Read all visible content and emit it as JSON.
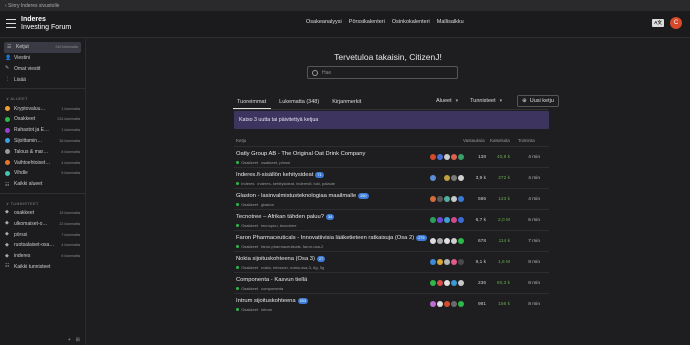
{
  "topstrip": {
    "back_label": "‹ Siirry Inderes sivustolle"
  },
  "brand": {
    "line1": "Inderes",
    "line2": "Investing Forum"
  },
  "topnav": [
    "Osakeanalyysi",
    "Pörssikalenteri",
    "Osinkokalenteri",
    "Mallisalkku"
  ],
  "header": {
    "lang": "A文",
    "avatar": "C"
  },
  "sidebar": {
    "top": [
      {
        "label": "Ketjut",
        "count": "240 lukematta",
        "icon": "☰",
        "active": true
      },
      {
        "label": "Viestini",
        "count": "",
        "icon": "👤",
        "active": false
      },
      {
        "label": "Omat viestit",
        "count": "",
        "icon": "✎",
        "active": false
      },
      {
        "label": "Lisää",
        "count": "",
        "icon": "⋮",
        "active": false
      }
    ],
    "alueet_head": "∨ ALUEET",
    "alueet": [
      {
        "label": "Kryptovaluu…",
        "count": "1 lukematta",
        "color": "#f0a030"
      },
      {
        "label": "Osakkeet",
        "count": "234 lukematta",
        "color": "#2db84a"
      },
      {
        "label": "Rahastot ja E…",
        "count": "1 lukematta",
        "color": "#9b3fd4"
      },
      {
        "label": "Sijoittamin…",
        "count": "36 lukematta",
        "color": "#3aa0e6"
      },
      {
        "label": "Talous & mar…",
        "count": "8 lukematta",
        "color": "#9a9a9a"
      },
      {
        "label": "Vaihtoehtoiset…",
        "count": "4 lukematta",
        "color": "#e8742a"
      },
      {
        "label": "Vihdle",
        "count": "5 lukematta",
        "color": "#44c2b4"
      },
      {
        "label": "Kaikki alueet",
        "count": "",
        "color": ""
      }
    ],
    "tunnisteet_head": "∨ TUNNISTEET",
    "tunnisteet": [
      {
        "label": "osakkeet",
        "count": "15 lukematta"
      },
      {
        "label": "ulkomaiset-o…",
        "count": "22 lukematta"
      },
      {
        "label": "pörssi",
        "count": "7 lukematta"
      },
      {
        "label": "ruotsalaiset-osa…",
        "count": "4 lukematta"
      },
      {
        "label": "inderes",
        "count": "6 lukematta"
      },
      {
        "label": "Kaikki tunnisteet",
        "count": ""
      }
    ],
    "footer": [
      "+",
      "⊞"
    ]
  },
  "welcome": "Tervetuloa takaisin, CitizenJ!",
  "search": {
    "placeholder": "Hae"
  },
  "tabs": [
    "Tuoreimmat",
    "Lukematta (348)",
    "Kirjanmerkit"
  ],
  "tools": {
    "area": "Alueet",
    "tags": "Tunnisteet",
    "new_topic": "Uusi ketju"
  },
  "notice": "Katso 3 uutta tai päivitettyä ketjua",
  "table_head": {
    "topic": "Ketju",
    "replies": "Vastauksia",
    "views": "Katseluita",
    "activity": "Toiminta"
  },
  "topics": [
    {
      "title": "Oatly Group AB - The Original Oat Drink Company",
      "badge": "",
      "category": "Osakkeet",
      "tags": "osakkeet, pörssi",
      "replies": "138",
      "views": "40,8 k",
      "activity": "4 min",
      "avatars": [
        "#d64a2c",
        "#4a6fd6",
        "#ccc",
        "#e06050",
        "#3aa06a"
      ]
    },
    {
      "title": "Inderes.fi-sisällön kehitysideat",
      "badge": "71",
      "category": "Inderes",
      "tags": "inderes, kehitysideat, inderesfi, tuki, palaute",
      "replies": "3,9 k",
      "views": "272 k",
      "activity": "4 min",
      "avatars": [
        "#5a8fd6",
        "#222",
        "#c0a040",
        "#7a7a7a",
        "#d0d0d0"
      ]
    },
    {
      "title": "Glaston - lasinvalmistusteknologiaa maailmalle",
      "badge": "250",
      "category": "Osakkeet",
      "tags": "glaston",
      "replies": "586",
      "views": "123 k",
      "activity": "4 min",
      "avatars": [
        "#d66a3a",
        "#5a5a5a",
        "#50b0a0",
        "#c8c8c8",
        "#3a7ad6"
      ]
    },
    {
      "title": "Tecnotree – Afrikan tähden paluu?",
      "badge": "34",
      "category": "Osakkeet",
      "tags": "tecnopuu, tecnotree",
      "replies": "6,7 k",
      "views": "2,0 M",
      "activity": "6 min",
      "avatars": [
        "#2aa05a",
        "#6a4ad6",
        "#40a0d0",
        "#d04a8a",
        "#3a6ad6"
      ]
    },
    {
      "title": "Faron Pharmaceuticals - Innovatiivisia lääketieteen ratkaisuja (Osa 2)",
      "badge": "279",
      "category": "Osakkeet",
      "tags": "faron-pharmaceuticals, faron-osa-2",
      "replies": "678",
      "views": "114 k",
      "activity": "7 min",
      "avatars": [
        "#dddddd",
        "#aaaaaa",
        "#e0e0e0",
        "#cfcfcf",
        "#2db84a"
      ]
    },
    {
      "title": "Nokia sijoituskohteena (Osa 3)",
      "badge": "27",
      "category": "Osakkeet",
      "tags": "nokia, ericsson, nokia-osa-3, 6g, 5g",
      "replies": "9,1 k",
      "views": "1,6 M",
      "activity": "8 min",
      "avatars": [
        "#3a8ad6",
        "#d6a83a",
        "#b8b8b8",
        "#e05a8a",
        "#4a4a4a"
      ]
    },
    {
      "title": "Componenta - Kasvun tiellä",
      "badge": "",
      "category": "Osakkeet",
      "tags": "componenta",
      "replies": "236",
      "views": "60,3 k",
      "activity": "8 min",
      "avatars": [
        "#2db84a",
        "#d6504a",
        "#e0e0e0",
        "#3a9ad6",
        "#c8c8c8"
      ]
    },
    {
      "title": "Intrum sijoituskohteena",
      "badge": "553",
      "category": "Osakkeet",
      "tags": "intrum",
      "replies": "981",
      "views": "156 k",
      "activity": "8 min",
      "avatars": [
        "#c06ad6",
        "#dddddd",
        "#d64a2c",
        "#6a6a6a",
        "#2db84a"
      ]
    }
  ]
}
